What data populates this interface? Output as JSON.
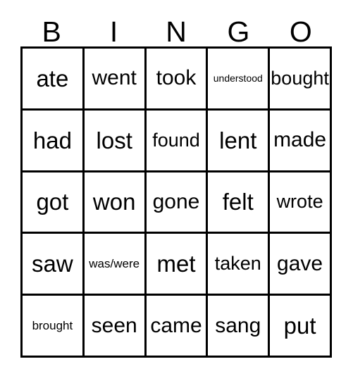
{
  "card": {
    "header_letters": [
      "B",
      "I",
      "N",
      "G",
      "O"
    ],
    "rows": [
      [
        {
          "text": "ate",
          "size": "xl"
        },
        {
          "text": "went",
          "size": "lg"
        },
        {
          "text": "took",
          "size": "lg"
        },
        {
          "text": "understood",
          "size": "xs"
        },
        {
          "text": "bought",
          "size": "md"
        }
      ],
      [
        {
          "text": "had",
          "size": "xl"
        },
        {
          "text": "lost",
          "size": "xl"
        },
        {
          "text": "found",
          "size": "md"
        },
        {
          "text": "lent",
          "size": "xl"
        },
        {
          "text": "made",
          "size": "lg"
        }
      ],
      [
        {
          "text": "got",
          "size": "xl"
        },
        {
          "text": "won",
          "size": "xl"
        },
        {
          "text": "gone",
          "size": "lg"
        },
        {
          "text": "felt",
          "size": "xl"
        },
        {
          "text": "wrote",
          "size": "md"
        }
      ],
      [
        {
          "text": "saw",
          "size": "xl"
        },
        {
          "text": "was/were",
          "size": "sm"
        },
        {
          "text": "met",
          "size": "xl"
        },
        {
          "text": "taken",
          "size": "md"
        },
        {
          "text": "gave",
          "size": "lg"
        }
      ],
      [
        {
          "text": "brought",
          "size": "sm"
        },
        {
          "text": "seen",
          "size": "lg"
        },
        {
          "text": "came",
          "size": "lg"
        },
        {
          "text": "sang",
          "size": "lg"
        },
        {
          "text": "put",
          "size": "xl"
        }
      ]
    ],
    "colors": {
      "grid_line": "#000000",
      "text": "#000000",
      "background": "#ffffff"
    }
  }
}
